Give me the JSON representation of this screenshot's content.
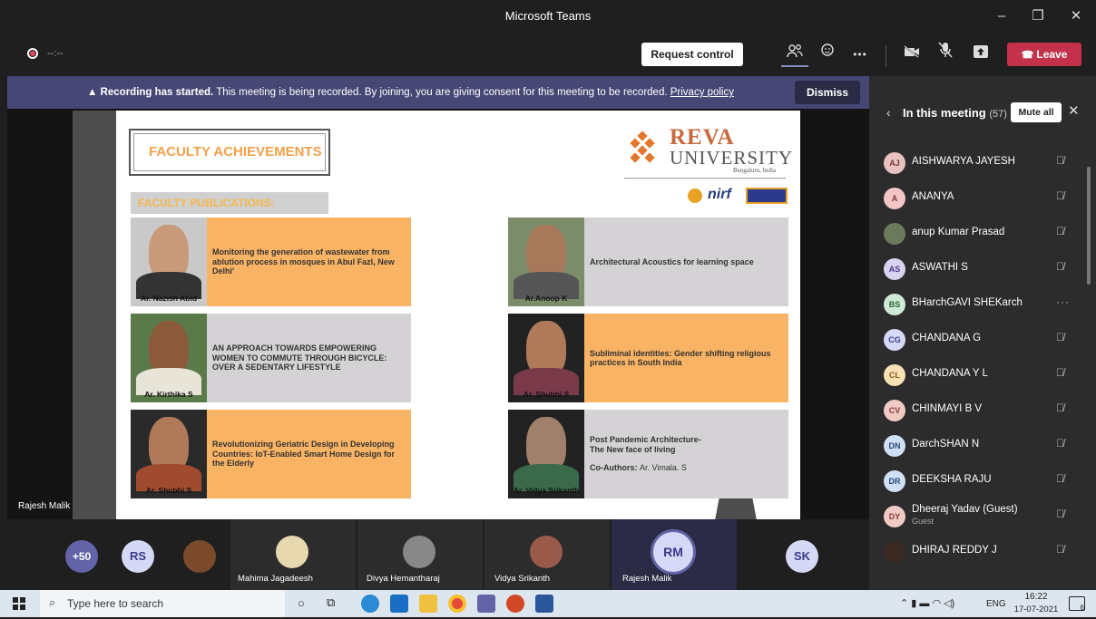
{
  "window": {
    "title": "Microsoft Teams",
    "minimize": "–",
    "maximize": "❐",
    "close": "✕"
  },
  "toolbar": {
    "timer": "--:--",
    "request_control": "Request control",
    "leave": "Leave",
    "more": "•••"
  },
  "banner": {
    "bold": "Recording has started.",
    "text": "This meeting is being recorded. By joining, you are giving consent for this meeting to be recorded.",
    "link": "Privacy policy",
    "dismiss": "Dismiss"
  },
  "stage": {
    "presenter_name": "Rajesh Malik"
  },
  "slide": {
    "heading": "FACULTY ACHIEVEMENTS",
    "subheading": "FACULTY PUBLICATIONS:",
    "logo_line1": "REVA",
    "logo_line2": "UNIVERSITY",
    "logo_line3": "Bengaluru, India",
    "nirf": "nirf",
    "cards": [
      {
        "name": "Ar. Nazish Abid",
        "title": "Monitoring the generation of wastewater from ablution process in mosques in Abul Fazl, New Delhi'",
        "extra": ""
      },
      {
        "name": "Ar.Anoop K",
        "title": "Architectural Acoustics for learning space",
        "extra": ""
      },
      {
        "name": "Ar. Kirthika S",
        "title": "AN APPROACH TOWARDS EMPOWERING WOMEN TO COMMUTE THROUGH BICYCLE: OVER A SEDENTARY LIFESTYLE",
        "extra": ""
      },
      {
        "name": "Ar. Shubhi S",
        "title": "Subliminal identities: Gender shifting religious practices in South India",
        "extra": ""
      },
      {
        "name": "Ar. Shubhi S",
        "title": "Revolutionizing Geriatric Design in Developing Countries: IoT-Enabled Smart Home Design for the Elderly",
        "extra": ""
      },
      {
        "name": "Ar. Vidya Srikanth",
        "title": "Post Pandemic Architecture-\nThe New face of living",
        "extra_label": "Co-Authors:",
        "extra": "Ar. Vimala. S"
      }
    ]
  },
  "panel": {
    "title": "In this meeting",
    "count": "(57)",
    "mute_all": "Mute all",
    "participants": [
      {
        "initials": "AJ",
        "name": "AISHWARYA JAYESH",
        "color": "#e8c1c1",
        "status": "muted"
      },
      {
        "initials": "A",
        "name": "ANANYA",
        "color": "#f2c6c6",
        "status": "muted"
      },
      {
        "initials": "",
        "name": "anup Kumar Prasad",
        "color": "#6a7a5a",
        "status": "muted"
      },
      {
        "initials": "AS",
        "name": "ASWATHI S",
        "color": "#d9d2f0",
        "status": "muted"
      },
      {
        "initials": "BS",
        "name": "BHarchGAVI SHEKarch",
        "color": "#cfe9d7",
        "status": "more"
      },
      {
        "initials": "CG",
        "name": "CHANDANA G",
        "color": "#d6d9f5",
        "status": "muted"
      },
      {
        "initials": "CL",
        "name": "CHANDANA Y L",
        "color": "#f7e1b5",
        "status": "muted"
      },
      {
        "initials": "CV",
        "name": "CHINMAYI B V",
        "color": "#f0cbc6",
        "status": "muted"
      },
      {
        "initials": "DN",
        "name": "DarchSHAN N",
        "color": "#cfe0f5",
        "status": "muted"
      },
      {
        "initials": "DR",
        "name": "DEEKSHA RAJU",
        "color": "#cfe0f5",
        "status": "muted"
      },
      {
        "initials": "DY",
        "name": "Dheeraj Yadav (Guest)",
        "sub": "Guest",
        "color": "#f0cbc6",
        "status": "muted"
      },
      {
        "initials": "",
        "name": "DHIRAJ REDDY J",
        "color": "#3a2a22",
        "status": "muted"
      }
    ]
  },
  "strip": {
    "overflow": "+50",
    "rs": "RS",
    "sk": "SK",
    "rm": "RM",
    "names": [
      "Mahima Jagadeesh",
      "Divya Hemantharaj",
      "Vidya Srikanth",
      "Rajesh Malik"
    ]
  },
  "taskbar": {
    "search_placeholder": "Type here to search",
    "lang": "ENG",
    "time": "16:22",
    "date": "17-07-2021",
    "notif": "6"
  }
}
